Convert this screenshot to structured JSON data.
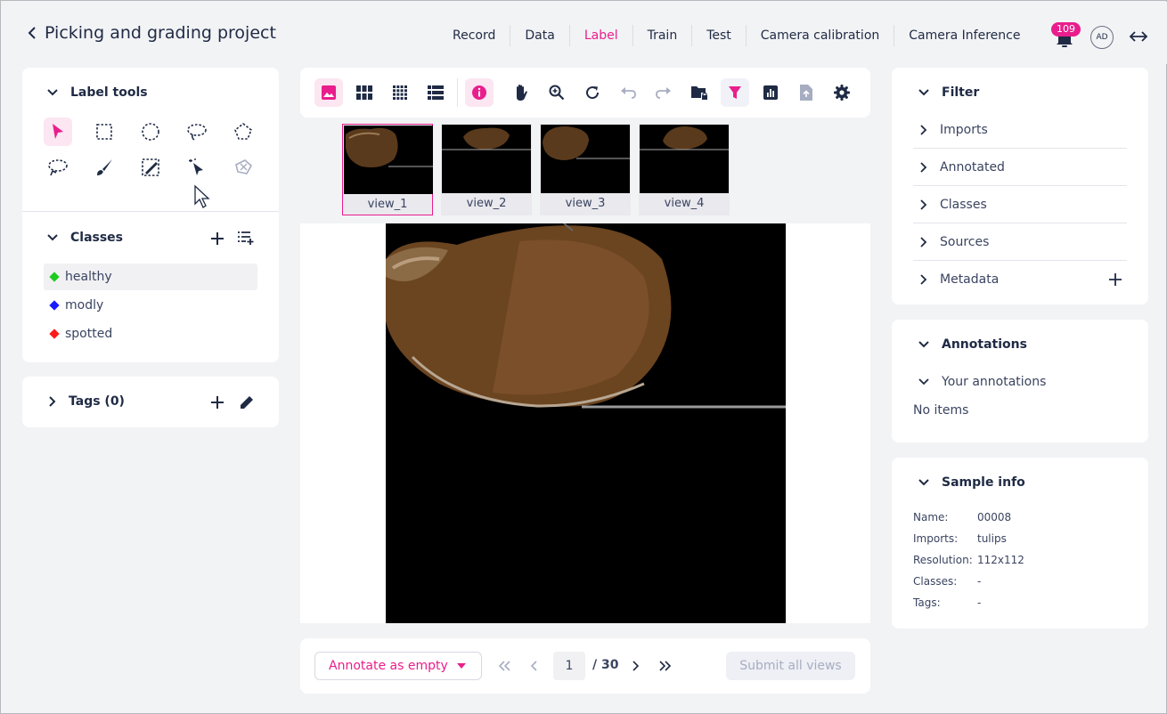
{
  "header": {
    "project_title": "Picking and grading project",
    "tabs": [
      {
        "label": "Record"
      },
      {
        "label": "Data"
      },
      {
        "label": "Label"
      },
      {
        "label": "Train"
      },
      {
        "label": "Test"
      },
      {
        "label": "Camera calibration"
      },
      {
        "label": "Camera Inference"
      }
    ],
    "active_tab": "Label",
    "notification_count": "109",
    "avatar_initials": "AD"
  },
  "label_tools": {
    "title": "Label tools",
    "tools": [
      {
        "icon": "select-arrow-icon",
        "active": true
      },
      {
        "icon": "rectangle-select-icon"
      },
      {
        "icon": "ellipse-select-icon"
      },
      {
        "icon": "lasso-icon"
      },
      {
        "icon": "polygon-icon"
      },
      {
        "icon": "freehand-lasso-icon"
      },
      {
        "icon": "brush-icon"
      },
      {
        "icon": "eraser-box-icon"
      },
      {
        "icon": "magic-wand-icon"
      },
      {
        "icon": "polygon-clear-icon",
        "disabled": true
      }
    ]
  },
  "classes": {
    "title": "Classes",
    "items": [
      {
        "label": "healthy",
        "color": "#1ecb1e",
        "selected": true
      },
      {
        "label": "modly",
        "color": "#1a1aff"
      },
      {
        "label": "spotted",
        "color": "#ff1a1a"
      }
    ]
  },
  "tags": {
    "title": "Tags (0)"
  },
  "toolbar": {
    "icons": [
      "single-image-icon",
      "grid-view-icon",
      "dense-grid-icon",
      "list-view-icon",
      "info-icon",
      "pan-hand-icon",
      "zoom-in-icon",
      "rotate-icon",
      "undo-icon",
      "redo-icon",
      "folder-lock-icon",
      "filter-icon",
      "stats-icon",
      "upload-file-icon",
      "settings-icon"
    ]
  },
  "views": [
    {
      "label": "view_1",
      "selected": true
    },
    {
      "label": "view_2"
    },
    {
      "label": "view_3"
    },
    {
      "label": "view_4"
    }
  ],
  "footer": {
    "annotate_label": "Annotate as empty",
    "current_page": "1",
    "total_pages": "/ 30",
    "submit_label": "Submit all views"
  },
  "filter": {
    "title": "Filter",
    "items": [
      {
        "label": "Imports"
      },
      {
        "label": "Annotated"
      },
      {
        "label": "Classes"
      },
      {
        "label": "Sources"
      },
      {
        "label": "Metadata"
      }
    ]
  },
  "annotations": {
    "title": "Annotations",
    "your_annotations": "Your annotations",
    "empty_text": "No items"
  },
  "sample_info": {
    "title": "Sample info",
    "rows": [
      {
        "key": "Name:",
        "value": "00008"
      },
      {
        "key": "Imports:",
        "value": "tulips"
      },
      {
        "key": "Resolution:",
        "value": "112x112"
      },
      {
        "key": "Classes:",
        "value": "-"
      },
      {
        "key": "Tags:",
        "value": "-"
      }
    ]
  },
  "colors": {
    "accent": "#e91e8c",
    "text": "#1f2a44",
    "background": "#f2f3f5"
  }
}
